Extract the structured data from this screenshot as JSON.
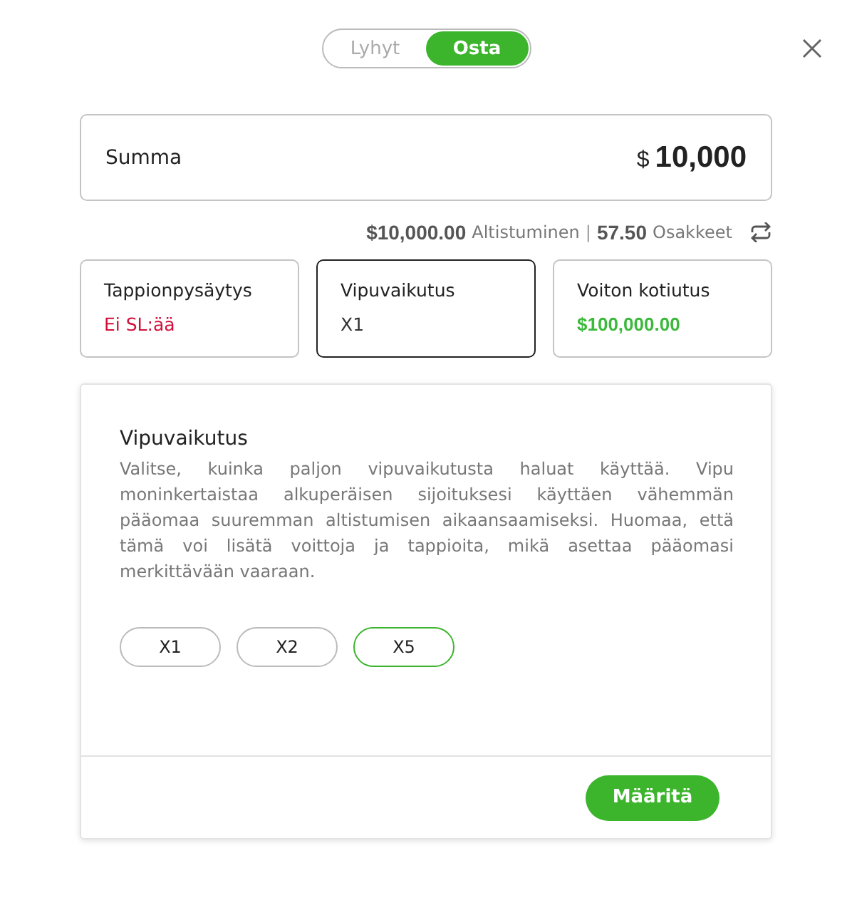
{
  "toggle": [
    {
      "label": "Lyhyt",
      "selected": false
    },
    {
      "label": "Osta",
      "selected": true
    }
  ],
  "amount": {
    "label": "Summa",
    "currency": "$",
    "value": "10,000"
  },
  "summary": {
    "exposure_value": "$10,000.00",
    "exposure_label": "Altistuminen",
    "separator": "|",
    "shares_value": "57.50",
    "shares_label": "Osakkeet"
  },
  "cards": [
    {
      "title": "Tappionpysäytys",
      "value": "Ei SL:ää",
      "color": "#d0103a",
      "selected": false
    },
    {
      "title": "Vipuvaikutus",
      "value": "X1",
      "color": "#333333",
      "selected": true
    },
    {
      "title": "Voiton kotiutus",
      "value": "$100,000.00",
      "color": "#3cb93c",
      "selected": false
    }
  ],
  "panel": {
    "title": "Vipuvaikutus",
    "description": "Valitse, kuinka paljon vipuvaikutusta haluat käyttää. Vipu moninkertaistaa alkuperäisen sijoituksesi käyttäen vähemmän pääomaa suuremman altistumisen aikaansaamiseksi. Huomaa, että tämä voi lisätä voittoja ja tappioita, mikä asettaa pääomasi merkittävään vaaraan.",
    "options": [
      {
        "label": "X1",
        "selected": false
      },
      {
        "label": "X2",
        "selected": false
      },
      {
        "label": "X5",
        "selected": true
      }
    ],
    "button": "Määritä"
  }
}
